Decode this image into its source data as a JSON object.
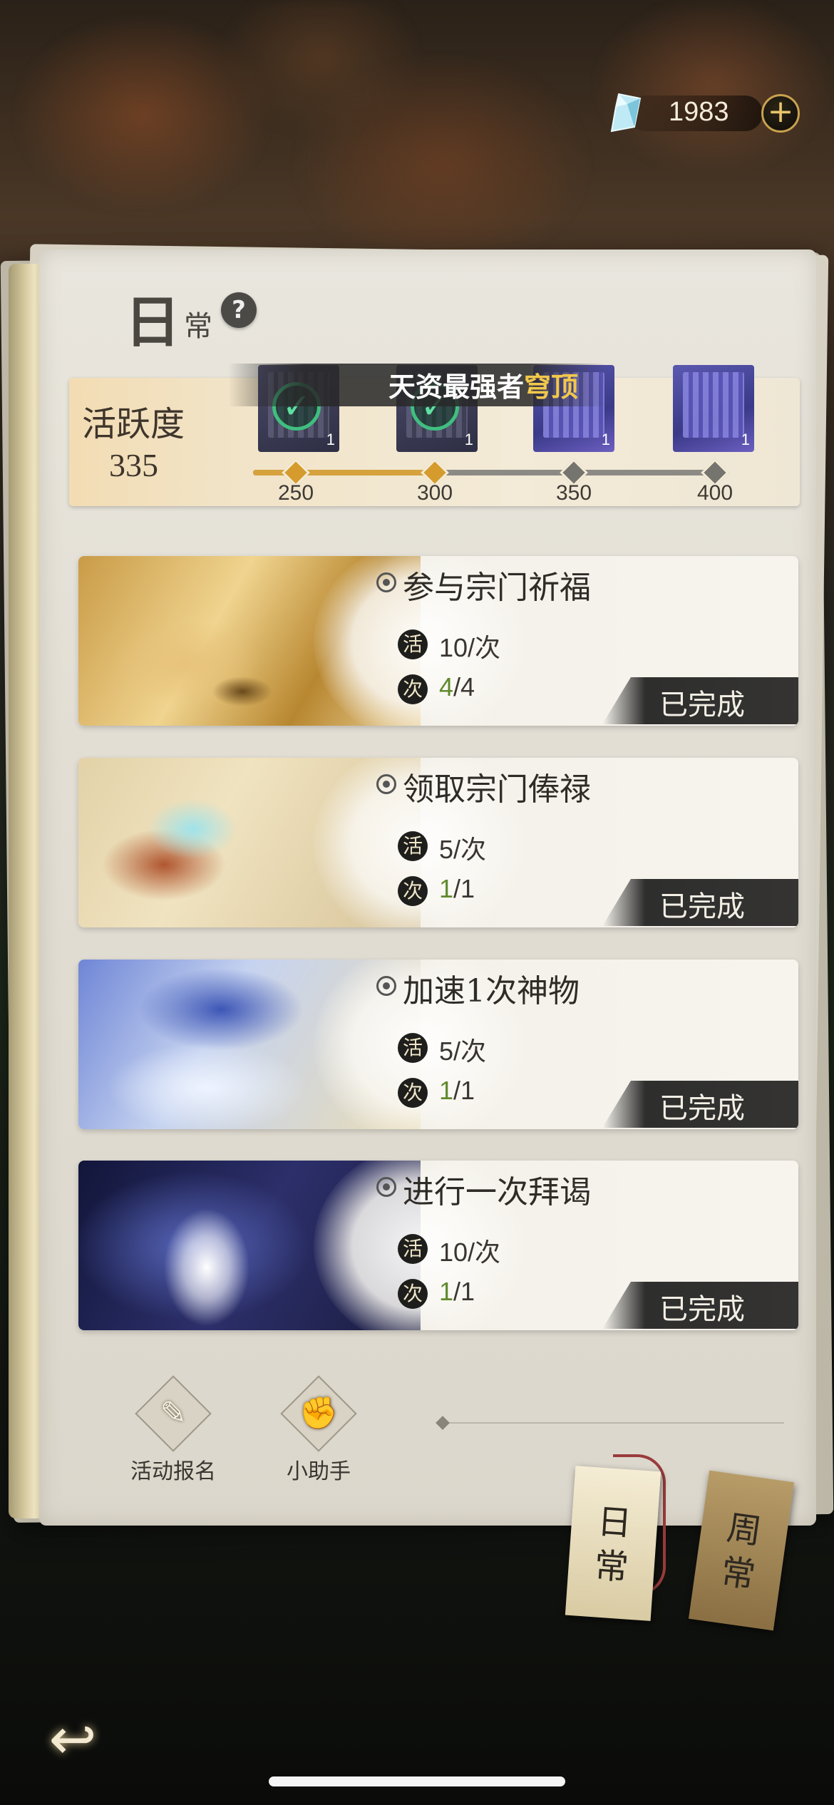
{
  "currency": {
    "icon": "crystal-icon",
    "value": "1983",
    "add_label": "+"
  },
  "header": {
    "title_main": "日",
    "title_sub": "常",
    "help_label": "?"
  },
  "activity": {
    "label": "活跃度",
    "score": "335",
    "banner": {
      "prefix": "天资最强者",
      "highlight": "穹顶"
    },
    "rewards": [
      {
        "count": "1",
        "claimed": true
      },
      {
        "count": "1",
        "claimed": true
      },
      {
        "count": "1",
        "claimed": false
      },
      {
        "count": "1",
        "claimed": false
      }
    ],
    "milestones": [
      "250",
      "300",
      "350",
      "400"
    ],
    "progress_fraction": 0.42
  },
  "tasks": [
    {
      "name": "参与宗门祈福",
      "points_tag": "活",
      "points": "10/次",
      "times_tag": "次",
      "times_done": "4",
      "times_total": "/4",
      "status": "已完成"
    },
    {
      "name": "领取宗门俸禄",
      "points_tag": "活",
      "points": "5/次",
      "times_tag": "次",
      "times_done": "1",
      "times_total": "/1",
      "status": "已完成"
    },
    {
      "name": "加速1次神物",
      "points_tag": "活",
      "points": "5/次",
      "times_tag": "次",
      "times_done": "1",
      "times_total": "/1",
      "status": "已完成"
    },
    {
      "name": "进行一次拜谒",
      "points_tag": "活",
      "points": "10/次",
      "times_tag": "次",
      "times_done": "1",
      "times_total": "/1",
      "status": "已完成"
    }
  ],
  "tools": [
    {
      "label": "活动报名",
      "icon": "scroll-quill-icon"
    },
    {
      "label": "小助手",
      "icon": "fist-icon"
    }
  ],
  "tabs": [
    {
      "label_1": "日",
      "label_2": "常",
      "active": true
    },
    {
      "label_1": "周",
      "label_2": "常",
      "active": false
    }
  ],
  "colors": {
    "accent_gold": "#d59b2d",
    "highlight": "#f2c84b",
    "done_green": "#5f8a2c"
  }
}
